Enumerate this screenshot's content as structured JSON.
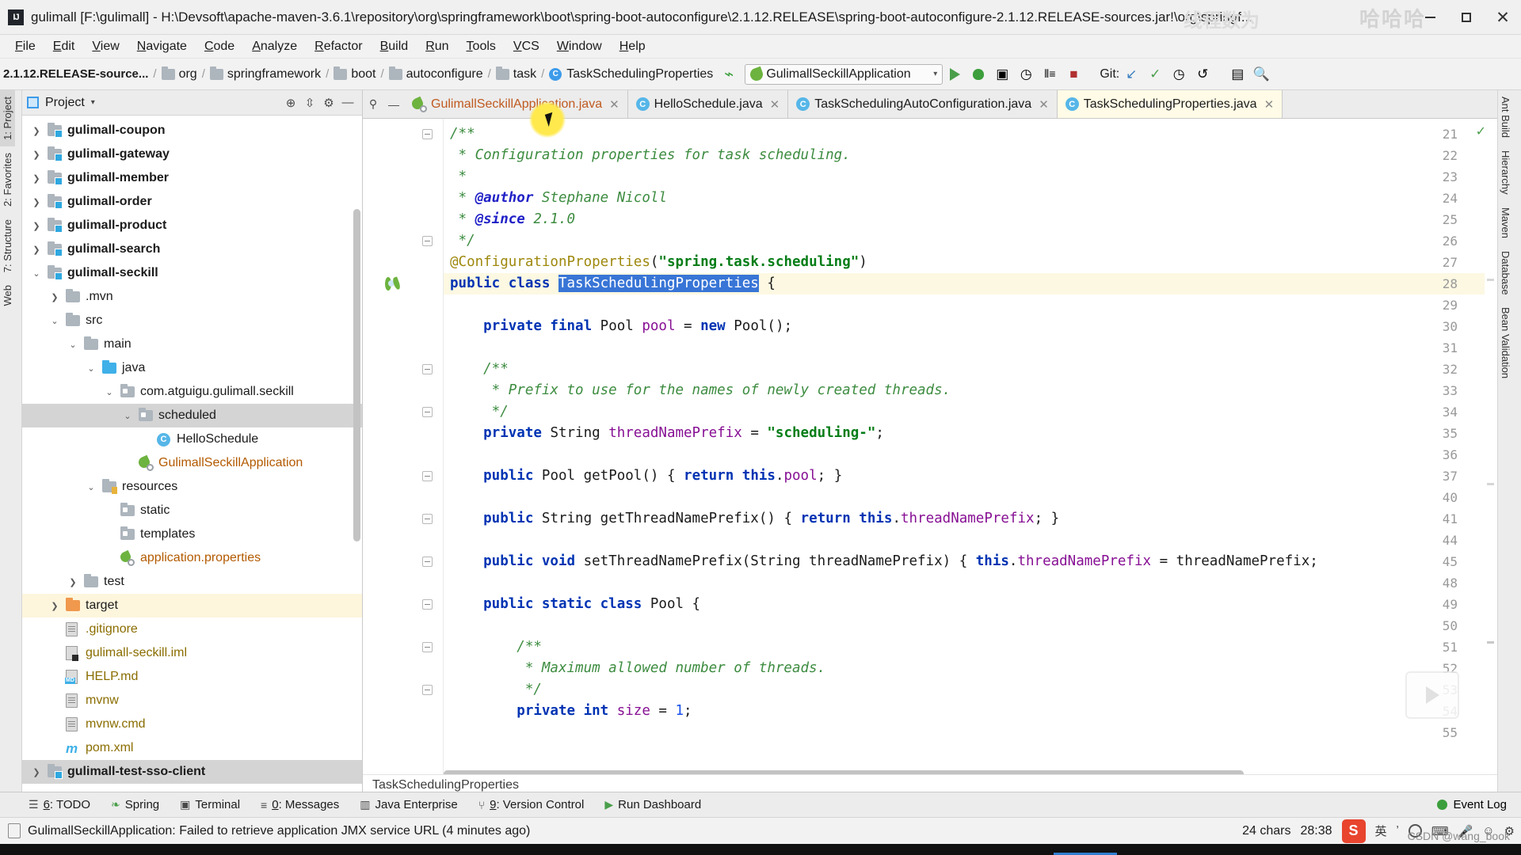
{
  "window": {
    "title": "gulimall [F:\\gulimall] - H:\\Devsoft\\apache-maven-3.6.1\\repository\\org\\springframework\\boot\\spring-boot-autoconfigure\\2.1.12.RELEASE\\spring-boot-autoconfigure-2.1.12.RELEASE-sources.jar!\\org\\springf...",
    "logo": "IJ",
    "watermark_cn": "哈哈哈",
    "watermark_cn2": "线程数为",
    "minimize": "—",
    "maximize": "□",
    "close": "✕"
  },
  "menubar": {
    "items": [
      "File",
      "Edit",
      "View",
      "Navigate",
      "Code",
      "Analyze",
      "Refactor",
      "Build",
      "Run",
      "Tools",
      "VCS",
      "Window",
      "Help"
    ]
  },
  "toolbar": {
    "breadcrumb_root": "2.1.12.RELEASE-source...",
    "breadcrumb": [
      {
        "label": "org",
        "icon": "folder-icon"
      },
      {
        "label": "springframework",
        "icon": "folder-icon"
      },
      {
        "label": "boot",
        "icon": "folder-icon"
      },
      {
        "label": "autoconfigure",
        "icon": "folder-icon"
      },
      {
        "label": "task",
        "icon": "folder-icon"
      },
      {
        "label": "TaskSchedulingProperties",
        "icon": "class-icon"
      }
    ],
    "class_initial": "C",
    "run_config": "GulimallSeckillApplication",
    "run_config_caret": "▾",
    "git_label": "Git:",
    "separator": "/"
  },
  "left_stripe": {
    "items": [
      {
        "label": "1: Project",
        "selected": true
      },
      {
        "label": "2: Favorites",
        "selected": false
      },
      {
        "label": "7: Structure",
        "selected": false
      },
      {
        "label": "Web",
        "selected": false
      }
    ]
  },
  "right_stripe": {
    "items": [
      {
        "label": "Ant Build"
      },
      {
        "label": "Hierarchy"
      },
      {
        "label": "Maven"
      },
      {
        "label": "Database"
      },
      {
        "label": "Bean Validation"
      }
    ]
  },
  "project_panel": {
    "title": "Project",
    "dropdown_caret": "▾",
    "locate_icon": "target-icon",
    "collapse_icon": "collapse-all-icon",
    "settings_icon": "gear-icon",
    "hide_icon": "hide-icon",
    "tree": [
      {
        "label": "gulimall-coupon",
        "depth": 1,
        "arrow": "collapsed",
        "icon": "module-folder",
        "style": "bold"
      },
      {
        "label": "gulimall-gateway",
        "depth": 1,
        "arrow": "collapsed",
        "icon": "module-folder",
        "style": "bold"
      },
      {
        "label": "gulimall-member",
        "depth": 1,
        "arrow": "collapsed",
        "icon": "module-folder",
        "style": "bold"
      },
      {
        "label": "gulimall-order",
        "depth": 1,
        "arrow": "collapsed",
        "icon": "module-folder",
        "style": "bold"
      },
      {
        "label": "gulimall-product",
        "depth": 1,
        "arrow": "collapsed",
        "icon": "module-folder",
        "style": "bold"
      },
      {
        "label": "gulimall-search",
        "depth": 1,
        "arrow": "collapsed",
        "icon": "module-folder",
        "style": "bold"
      },
      {
        "label": "gulimall-seckill",
        "depth": 1,
        "arrow": "expanded",
        "icon": "module-folder",
        "style": "bold"
      },
      {
        "label": ".mvn",
        "depth": 2,
        "arrow": "collapsed",
        "icon": "plain-folder",
        "style": "normal"
      },
      {
        "label": "src",
        "depth": 2,
        "arrow": "expanded",
        "icon": "plain-folder",
        "style": "normal"
      },
      {
        "label": "main",
        "depth": 3,
        "arrow": "expanded",
        "icon": "plain-folder",
        "style": "normal"
      },
      {
        "label": "java",
        "depth": 4,
        "arrow": "expanded",
        "icon": "source-folder",
        "style": "normal"
      },
      {
        "label": "com.atguigu.gulimall.seckill",
        "depth": 5,
        "arrow": "expanded",
        "icon": "package-folder",
        "style": "normal"
      },
      {
        "label": "scheduled",
        "depth": 6,
        "arrow": "expanded",
        "icon": "package-folder",
        "style": "normal",
        "selected": true
      },
      {
        "label": "HelloSchedule",
        "depth": 7,
        "arrow": "none",
        "icon": "java-class",
        "style": "normal"
      },
      {
        "label": "GulimallSeckillApplication",
        "depth": 6,
        "arrow": "none",
        "icon": "spring-boot-app",
        "style": "orange"
      },
      {
        "label": "resources",
        "depth": 4,
        "arrow": "expanded",
        "icon": "resources-folder",
        "style": "normal"
      },
      {
        "label": "static",
        "depth": 5,
        "arrow": "none",
        "icon": "package-folder",
        "style": "normal"
      },
      {
        "label": "templates",
        "depth": 5,
        "arrow": "none",
        "icon": "package-folder",
        "style": "normal"
      },
      {
        "label": "application.properties",
        "depth": 5,
        "arrow": "none",
        "icon": "spring-properties",
        "style": "orange"
      },
      {
        "label": "test",
        "depth": 3,
        "arrow": "collapsed",
        "icon": "plain-folder",
        "style": "normal"
      },
      {
        "label": "target",
        "depth": 2,
        "arrow": "collapsed",
        "icon": "target-folder",
        "style": "normal",
        "highlight": true
      },
      {
        "label": ".gitignore",
        "depth": 2,
        "arrow": "none",
        "icon": "text-file",
        "style": "amber"
      },
      {
        "label": "gulimall-seckill.iml",
        "depth": 2,
        "arrow": "none",
        "icon": "iml-file",
        "style": "amber"
      },
      {
        "label": "HELP.md",
        "depth": 2,
        "arrow": "none",
        "icon": "md-file",
        "style": "amber"
      },
      {
        "label": "mvnw",
        "depth": 2,
        "arrow": "none",
        "icon": "text-file",
        "style": "amber"
      },
      {
        "label": "mvnw.cmd",
        "depth": 2,
        "arrow": "none",
        "icon": "text-file",
        "style": "amber"
      },
      {
        "label": "pom.xml",
        "depth": 2,
        "arrow": "none",
        "icon": "maven-file",
        "style": "amber"
      },
      {
        "label": "gulimall-test-sso-client",
        "depth": 1,
        "arrow": "collapsed",
        "icon": "module-folder",
        "style": "bold",
        "selected": true
      }
    ]
  },
  "editor": {
    "tabs": [
      {
        "label": "GulimallSeckillApplication.java",
        "icon": "spring-boot-app",
        "active": false,
        "modified": true,
        "close": "✕"
      },
      {
        "label": "HelloSchedule.java",
        "icon": "java-class",
        "active": false,
        "modified": false,
        "close": "✕"
      },
      {
        "label": "TaskSchedulingAutoConfiguration.java",
        "icon": "java-class",
        "active": false,
        "modified": false,
        "close": "✕"
      },
      {
        "label": "TaskSchedulingProperties.java",
        "icon": "java-class",
        "active": true,
        "modified": false,
        "close": "✕"
      }
    ],
    "pin_icon": "pin-icon",
    "minimize_icon": "minimize-icon",
    "breadcrumb_bottom": "TaskSchedulingProperties",
    "inspection_status": "✓",
    "lines": [
      {
        "n": 21,
        "fold": "open",
        "tokens": [
          {
            "t": "/**",
            "c": "cm"
          }
        ]
      },
      {
        "n": 22,
        "fold": null,
        "tokens": [
          {
            "t": " * Configuration properties for task scheduling.",
            "c": "cm"
          }
        ]
      },
      {
        "n": 23,
        "fold": null,
        "tokens": [
          {
            "t": " *",
            "c": "cm"
          }
        ]
      },
      {
        "n": 24,
        "fold": null,
        "tokens": [
          {
            "t": " * ",
            "c": "cm"
          },
          {
            "t": "@author",
            "c": "tg"
          },
          {
            "t": " Stephane Nicoll",
            "c": "cm"
          }
        ]
      },
      {
        "n": 25,
        "fold": null,
        "tokens": [
          {
            "t": " * ",
            "c": "cm"
          },
          {
            "t": "@since",
            "c": "tg"
          },
          {
            "t": " 2.1.0",
            "c": "cm"
          }
        ]
      },
      {
        "n": 26,
        "fold": "close",
        "tokens": [
          {
            "t": " */",
            "c": "cm"
          }
        ]
      },
      {
        "n": 27,
        "fold": null,
        "tokens": [
          {
            "t": "@ConfigurationProperties",
            "c": "an"
          },
          {
            "t": "(",
            "c": "plain"
          },
          {
            "t": "\"spring.task.scheduling\"",
            "c": "st"
          },
          {
            "t": ")",
            "c": "plain"
          }
        ]
      },
      {
        "n": 28,
        "fold": null,
        "marker": "spring",
        "highlight": true,
        "tokens": [
          {
            "t": "public class ",
            "c": "k"
          },
          {
            "t": "TaskSchedulingProperties",
            "c": "sel-tok"
          },
          {
            "t": " {",
            "c": "plain"
          }
        ]
      },
      {
        "n": 29,
        "fold": null,
        "tokens": []
      },
      {
        "n": 30,
        "fold": null,
        "tokens": [
          {
            "t": "    private final ",
            "c": "k"
          },
          {
            "t": "Pool ",
            "c": "plain"
          },
          {
            "t": "pool",
            "c": "fd"
          },
          {
            "t": " = ",
            "c": "plain"
          },
          {
            "t": "new ",
            "c": "k"
          },
          {
            "t": "Pool();",
            "c": "plain"
          }
        ]
      },
      {
        "n": 31,
        "fold": null,
        "tokens": []
      },
      {
        "n": 32,
        "fold": "open",
        "tokens": [
          {
            "t": "    /**",
            "c": "cm"
          }
        ]
      },
      {
        "n": 33,
        "fold": null,
        "tokens": [
          {
            "t": "     * Prefix to use for the names of newly created threads.",
            "c": "cm"
          }
        ]
      },
      {
        "n": 34,
        "fold": "close",
        "tokens": [
          {
            "t": "     */",
            "c": "cm"
          }
        ]
      },
      {
        "n": 35,
        "fold": null,
        "tokens": [
          {
            "t": "    private ",
            "c": "k"
          },
          {
            "t": "String ",
            "c": "plain"
          },
          {
            "t": "threadNamePrefix",
            "c": "fd"
          },
          {
            "t": " = ",
            "c": "plain"
          },
          {
            "t": "\"scheduling-\"",
            "c": "st"
          },
          {
            "t": ";",
            "c": "plain"
          }
        ]
      },
      {
        "n": 36,
        "fold": null,
        "tokens": []
      },
      {
        "n": 37,
        "fold": "open",
        "tokens": [
          {
            "t": "    public ",
            "c": "k"
          },
          {
            "t": "Pool getPool() { ",
            "c": "plain"
          },
          {
            "t": "return this",
            "c": "k"
          },
          {
            "t": ".",
            "c": "plain"
          },
          {
            "t": "pool",
            "c": "fd"
          },
          {
            "t": "; }",
            "c": "plain"
          }
        ]
      },
      {
        "n": 40,
        "fold": null,
        "tokens": []
      },
      {
        "n": 41,
        "fold": "open",
        "tokens": [
          {
            "t": "    public ",
            "c": "k"
          },
          {
            "t": "String getThreadNamePrefix() { ",
            "c": "plain"
          },
          {
            "t": "return this",
            "c": "k"
          },
          {
            "t": ".",
            "c": "plain"
          },
          {
            "t": "threadNamePrefix",
            "c": "fd"
          },
          {
            "t": "; }",
            "c": "plain"
          }
        ]
      },
      {
        "n": 44,
        "fold": null,
        "tokens": []
      },
      {
        "n": 45,
        "fold": "open",
        "tokens": [
          {
            "t": "    public void ",
            "c": "k"
          },
          {
            "t": "setThreadNamePrefix(String threadNamePrefix) { ",
            "c": "plain"
          },
          {
            "t": "this",
            "c": "k"
          },
          {
            "t": ".",
            "c": "plain"
          },
          {
            "t": "threadNamePrefix",
            "c": "fd"
          },
          {
            "t": " = threadNamePrefix;",
            "c": "plain"
          }
        ]
      },
      {
        "n": 48,
        "fold": null,
        "tokens": []
      },
      {
        "n": 49,
        "fold": "open",
        "tokens": [
          {
            "t": "    public static class ",
            "c": "k"
          },
          {
            "t": "Pool {",
            "c": "plain"
          }
        ]
      },
      {
        "n": 50,
        "fold": null,
        "tokens": []
      },
      {
        "n": 51,
        "fold": "open",
        "tokens": [
          {
            "t": "        /**",
            "c": "cm"
          }
        ]
      },
      {
        "n": 52,
        "fold": null,
        "tokens": [
          {
            "t": "         * Maximum allowed number of threads.",
            "c": "cm"
          }
        ]
      },
      {
        "n": 53,
        "fold": "close",
        "tokens": [
          {
            "t": "         */",
            "c": "cm"
          }
        ]
      },
      {
        "n": 54,
        "fold": null,
        "tokens": [
          {
            "t": "        private int ",
            "c": "k"
          },
          {
            "t": "size",
            "c": "fd"
          },
          {
            "t": " = ",
            "c": "plain"
          },
          {
            "t": "1",
            "c": "num"
          },
          {
            "t": ";",
            "c": "plain"
          }
        ]
      },
      {
        "n": 55,
        "fold": null,
        "tokens": []
      }
    ]
  },
  "bottom_bar": {
    "windows": [
      {
        "label": "6: TODO",
        "mnemonic": "6",
        "icon": "todo-icon"
      },
      {
        "label": "Spring",
        "mnemonic": "",
        "icon": "spring-leaf-icon"
      },
      {
        "label": "Terminal",
        "mnemonic": "",
        "icon": "terminal-icon"
      },
      {
        "label": "0: Messages",
        "mnemonic": "0",
        "icon": "messages-icon"
      },
      {
        "label": "Java Enterprise",
        "mnemonic": "",
        "icon": "java-enterprise-icon"
      },
      {
        "label": "9: Version Control",
        "mnemonic": "9",
        "icon": "version-control-icon"
      },
      {
        "label": "Run Dashboard",
        "mnemonic": "",
        "icon": "run-dashboard-icon"
      }
    ],
    "event_log": "Event Log"
  },
  "status_bar": {
    "message": "GulimallSeckillApplication: Failed to retrieve application JMX service URL (4 minutes ago)",
    "chars": "24 chars",
    "caret_position": "28:38",
    "ime_label": "英",
    "ime_logo": "S",
    "ime_items": [
      "⌨",
      "🎤",
      "☺",
      "⚙"
    ]
  },
  "footer": {
    "credit": "CSDN @wang_book"
  },
  "colors": {
    "accent_blue": "#3d9be9",
    "spring_green": "#6db33f",
    "selection_blue": "#3875d6",
    "highlight_yellow": "#fcf8e2",
    "target_orange": "#f0984d",
    "error_red": "#e81123"
  }
}
